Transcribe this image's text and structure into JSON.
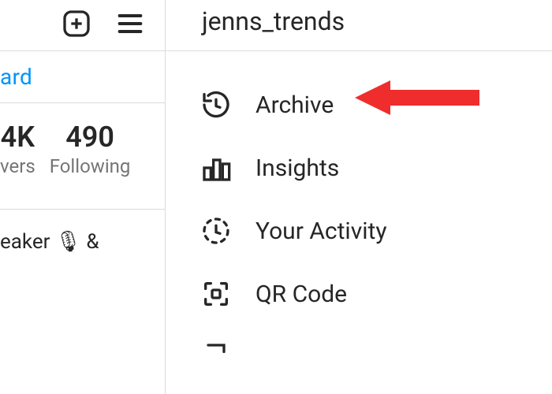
{
  "header": {
    "username": "jenns_trends"
  },
  "left": {
    "dashboard_text": "ard",
    "stats": [
      {
        "value": "4K",
        "label": "vers"
      },
      {
        "value": "490",
        "label": "Following"
      }
    ],
    "bio_fragment": "eaker 🎙 &"
  },
  "menu": {
    "items": [
      {
        "label": "Archive",
        "icon": "history"
      },
      {
        "label": "Insights",
        "icon": "chart"
      },
      {
        "label": "Your Activity",
        "icon": "activity"
      },
      {
        "label": "QR Code",
        "icon": "qr"
      },
      {
        "label": "",
        "icon": "saved"
      }
    ]
  }
}
